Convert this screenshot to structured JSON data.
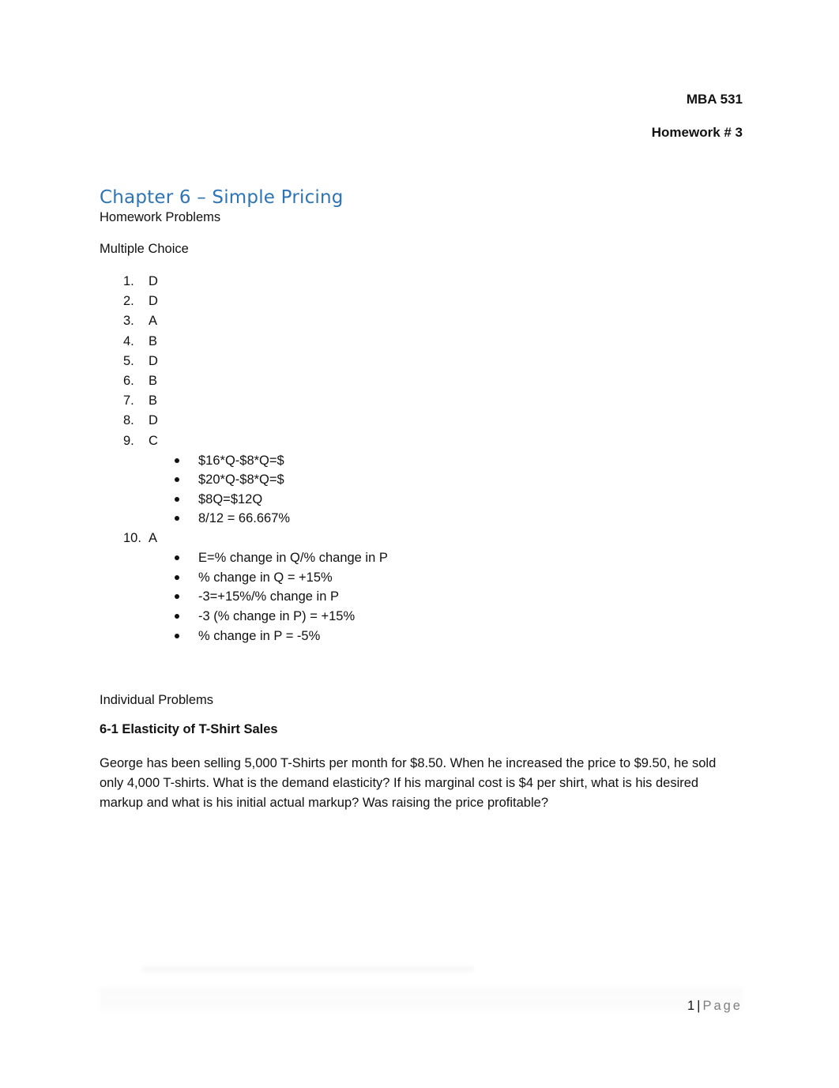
{
  "header": {
    "course": "MBA 531",
    "assignment": "Homework # 3"
  },
  "title": "Chapter 6 – Simple Pricing",
  "subtitle": "Homework Problems",
  "multiple_choice": {
    "heading": "Multiple Choice",
    "items": [
      {
        "num": "1.",
        "answer": "D",
        "notes": []
      },
      {
        "num": "2.",
        "answer": "D",
        "notes": []
      },
      {
        "num": "3.",
        "answer": "A",
        "notes": []
      },
      {
        "num": "4.",
        "answer": "B",
        "notes": []
      },
      {
        "num": "5.",
        "answer": "D",
        "notes": []
      },
      {
        "num": "6.",
        "answer": "B",
        "notes": []
      },
      {
        "num": "7.",
        "answer": "B",
        "notes": []
      },
      {
        "num": "8.",
        "answer": "D",
        "notes": []
      },
      {
        "num": "9.",
        "answer": "C",
        "notes": [
          "$16*Q-$8*Q=$",
          "$20*Q-$8*Q=$",
          "$8Q=$12Q",
          "8/12  = 66.667%"
        ]
      },
      {
        "num": "10.",
        "answer": "A",
        "notes": [
          "E=% change in Q/% change in P",
          "% change in Q = +15%",
          "-3=+15%/%  change in P",
          "-3 (% change in P) = +15%",
          "% change in P = -5%"
        ]
      }
    ]
  },
  "individual_problems": {
    "heading": "Individual Problems",
    "problem_title": "6-1 Elasticity of T-Shirt Sales",
    "problem_text": "George has been selling 5,000 T-Shirts per month for $8.50. When he increased the price to $9.50, he sold only 4,000 T-shirts. What is the demand elasticity? If his marginal cost is $4 per shirt, what is his desired markup and what is his initial actual markup? Was raising the price profitable?"
  },
  "footer": {
    "page_number": "1",
    "separator": "|",
    "page_label": "Page"
  }
}
